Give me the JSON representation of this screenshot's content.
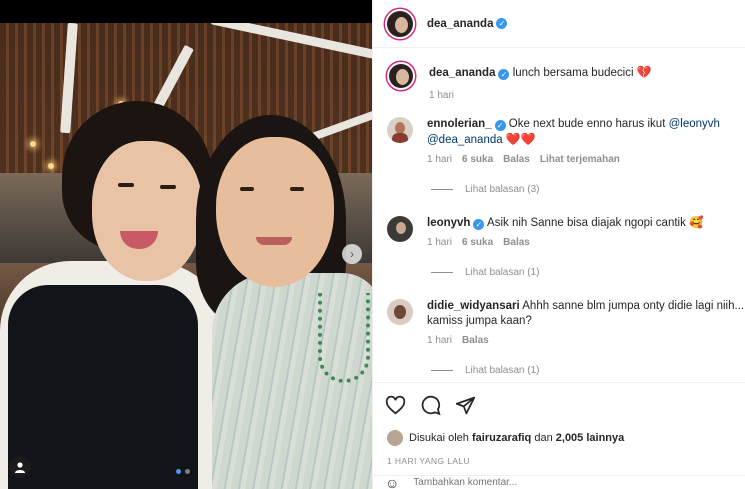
{
  "post": {
    "author": "dea_ananda",
    "verified": true,
    "caption": "lunch bersama budecici",
    "caption_emoji": "💔",
    "caption_time": "1 hari",
    "carousel": {
      "total": 2,
      "current": 1
    }
  },
  "comments": [
    {
      "user": "ennolerian_",
      "verified": true,
      "text_parts": [
        "Oke next bude enno harus ikut ",
        "@leonyvh",
        " ",
        "@dea_ananda",
        " ",
        "❤️❤️"
      ],
      "time": "1 hari",
      "likes": "6 suka",
      "reply_label": "Balas",
      "translate_label": "Lihat terjemahan",
      "replies_label": "Lihat balasan (3)"
    },
    {
      "user": "leonyvh",
      "verified": true,
      "text": "Asik nih Sanne bisa diajak ngopi cantik",
      "emoji": "🥰",
      "time": "1 hari",
      "likes": "6 suka",
      "reply_label": "Balas",
      "replies_label": "Lihat balasan (1)"
    },
    {
      "user": "didie_widyansari",
      "verified": false,
      "text": "Ahhh sanne blm jumpa onty didie lagi niih... kamiss jumpa kaan?",
      "time": "1 hari",
      "reply_label": "Balas",
      "replies_label": "Lihat balasan (1)"
    }
  ],
  "likes": {
    "prefix": "Disukai oleh",
    "user": "fairuzarafiq",
    "middle": "dan",
    "count": "2,005 lainnya"
  },
  "timestamp": "1 HARI YANG LALU",
  "add_comment": {
    "placeholder": "Tambahkan komentar..."
  },
  "icons": {
    "like": "heart-outline-icon",
    "comment": "speech-bubble-icon",
    "share": "paper-plane-icon",
    "emoji": "smiley-icon",
    "next": "chevron-right-icon",
    "tags": "user-tag-icon"
  },
  "colors": {
    "verified": "#3897f0",
    "link": "#00376b",
    "muted": "#8e8e8e",
    "story_ring": "#d62976",
    "active_dot": "#4d96f5"
  }
}
